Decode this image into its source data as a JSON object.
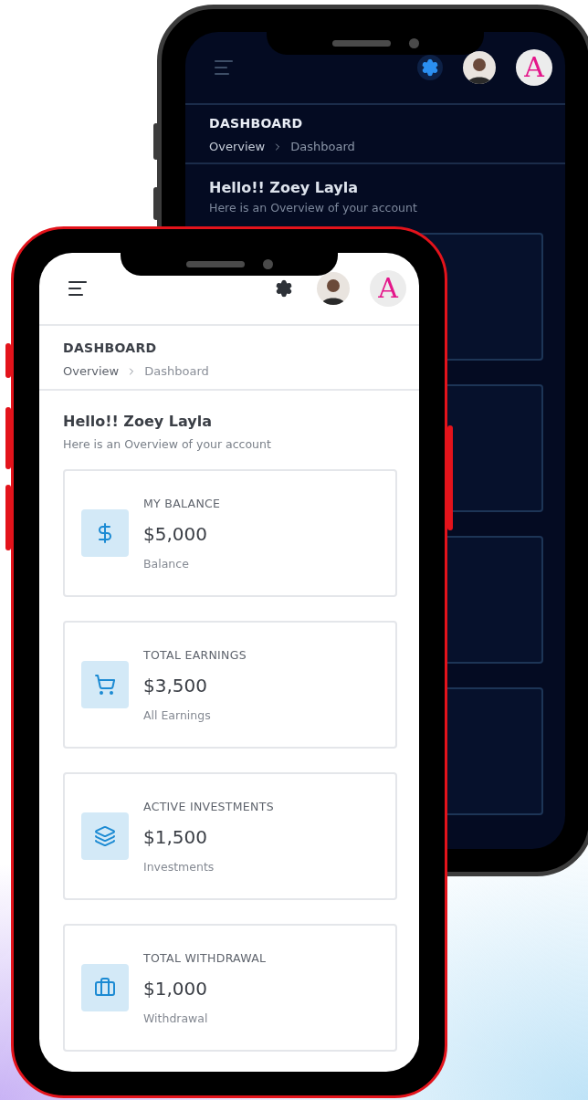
{
  "phones": [
    {
      "kind": "dark",
      "logo_letter": "A",
      "page_title": "DASHBOARD",
      "breadcrumb": [
        "Overview",
        "Dashboard"
      ],
      "greeting": "Hello!! Zoey Layla",
      "subtitle": "Here is an Overview of your account",
      "cards": [
        {
          "kind": "blank"
        },
        {
          "kind": "blank"
        },
        {
          "kind": "blank"
        },
        {
          "kind": "blank"
        }
      ]
    },
    {
      "kind": "light",
      "logo_letter": "A",
      "page_title": "DASHBOARD",
      "breadcrumb": [
        "Overview",
        "Dashboard"
      ],
      "greeting": "Hello!! Zoey Layla",
      "subtitle": "Here is an Overview of your account",
      "cards": [
        {
          "kind": "stat",
          "label": "MY BALANCE",
          "amount": "$5,000",
          "caption": "Balance"
        },
        {
          "kind": "stat",
          "label": "TOTAL EARNINGS",
          "amount": "$3,500",
          "caption": "All Earnings"
        },
        {
          "kind": "stat",
          "label": "ACTIVE INVESTMENTS",
          "amount": "$1,500",
          "caption": "Investments"
        },
        {
          "kind": "stat",
          "label": "TOTAL WITHDRAWAL",
          "amount": "$1,000",
          "caption": "Withdrawal"
        }
      ]
    }
  ]
}
